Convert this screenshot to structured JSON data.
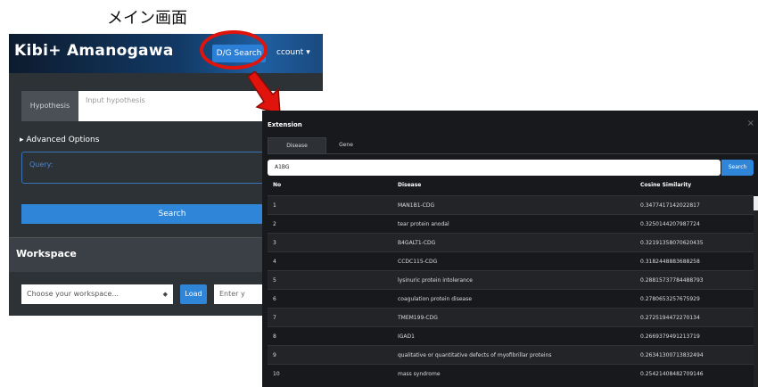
{
  "caption": "メイン画面",
  "main": {
    "brand": "Kibi+ Amanogawa",
    "dg_search": "D/G Search",
    "account": "ccount ▾",
    "hypothesis_label": "Hypothesis",
    "hypothesis_placeholder": "Input hypothesis",
    "advanced_options": "▸ Advanced Options",
    "query_placeholder": "Query:",
    "search_button": "Search",
    "workspace_title": "Workspace",
    "workspace_select": "Choose your workspace...",
    "load_button": "Load",
    "enter_input": "Enter y"
  },
  "annotation": {
    "ellipse_color": "#e0140c",
    "arrow_color": "#e0140c"
  },
  "extension": {
    "title": "Extension",
    "close": "×",
    "tabs": [
      {
        "label": "Disease",
        "active": true
      },
      {
        "label": "Gene",
        "active": false
      }
    ],
    "search_value": "A1BG",
    "search_button": "Search",
    "columns": [
      "No",
      "Disease",
      "Cosine Similarity"
    ],
    "rows": [
      {
        "no": "1",
        "disease": "MAN1B1-CDG",
        "sim": "0.3477417142022817"
      },
      {
        "no": "2",
        "disease": "tear protein anodal",
        "sim": "0.3250144207987724"
      },
      {
        "no": "3",
        "disease": "B4GALT1-CDG",
        "sim": "0.32191358070620435"
      },
      {
        "no": "4",
        "disease": "CCDC115-CDG",
        "sim": "0.3182448883688258"
      },
      {
        "no": "5",
        "disease": "lysinuric protein intolerance",
        "sim": "0.28815737784488793"
      },
      {
        "no": "6",
        "disease": "coagulation protein disease",
        "sim": "0.2780653257675929"
      },
      {
        "no": "7",
        "disease": "TMEM199-CDG",
        "sim": "0.2725194472270134"
      },
      {
        "no": "8",
        "disease": "IGAD1",
        "sim": "0.2669379491213719"
      },
      {
        "no": "9",
        "disease": "qualitative or quantitative defects of myofibrillar proteins",
        "sim": "0.26341300713832494"
      },
      {
        "no": "10",
        "disease": "mass syndrome",
        "sim": "0.25421408482709146"
      }
    ]
  }
}
